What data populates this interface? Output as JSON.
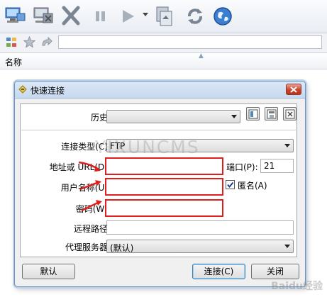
{
  "list": {
    "column_name": "名称"
  },
  "dialog": {
    "title": "快速连接",
    "history_label": "历史:",
    "conn_type_label": "连接类型(C):",
    "conn_type_value": "FTP",
    "address_label": "地址或 URL(D):",
    "port_label": "端口(P):",
    "port_value": "21",
    "username_label": "用户名称(U):",
    "anonymous_label": "匿名(A)",
    "password_label": "密码(W):",
    "remote_path_label": "远程路径:",
    "proxy_label": "代理服务器:",
    "proxy_value": "(默认)",
    "default_button": "默认",
    "connect_button": "连接(C)",
    "close_button": "关闭"
  },
  "watermark": "YIXUNCMS",
  "baidu_watermark": "Baidu经验",
  "colors": {
    "highlight_red": "#e11e1e",
    "title_bar": "#c6d9ef"
  }
}
